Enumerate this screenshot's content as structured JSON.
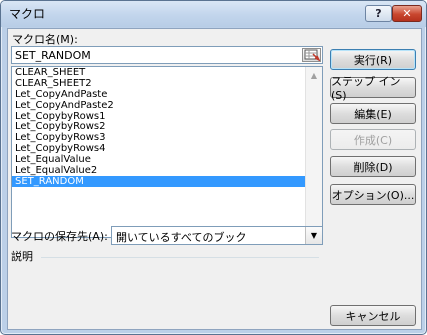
{
  "window": {
    "title": "マクロ",
    "help_glyph": "?",
    "close_glyph": "✕"
  },
  "macro_name": {
    "label": "マクロ名(M):",
    "value": "SET_RANDOM"
  },
  "macro_list": {
    "items": [
      "CLEAR_SHEET",
      "CLEAR_SHEET2",
      "Let_CopyAndPaste",
      "Let_CopyAndPaste2",
      "Let_CopybyRows1",
      "Let_CopybyRows2",
      "Let_CopybyRows3",
      "Let_CopybyRows4",
      "Let_EqualValue",
      "Let_EqualValue2",
      "SET_RANDOM"
    ],
    "selected": "SET_RANDOM"
  },
  "buttons": {
    "run": "実行(R)",
    "step_in": "ステップ イン(S)",
    "edit": "編集(E)",
    "create": "作成(C)",
    "delete": "削除(D)",
    "options": "オプション(O)...",
    "cancel": "キャンセル"
  },
  "location": {
    "label": "マクロの保存先(A):",
    "value": "開いているすべてのブック"
  },
  "description": {
    "label": "説明"
  },
  "icons": {
    "scroll_up": "▲",
    "scroll_down": "▼",
    "combo": "▼"
  }
}
